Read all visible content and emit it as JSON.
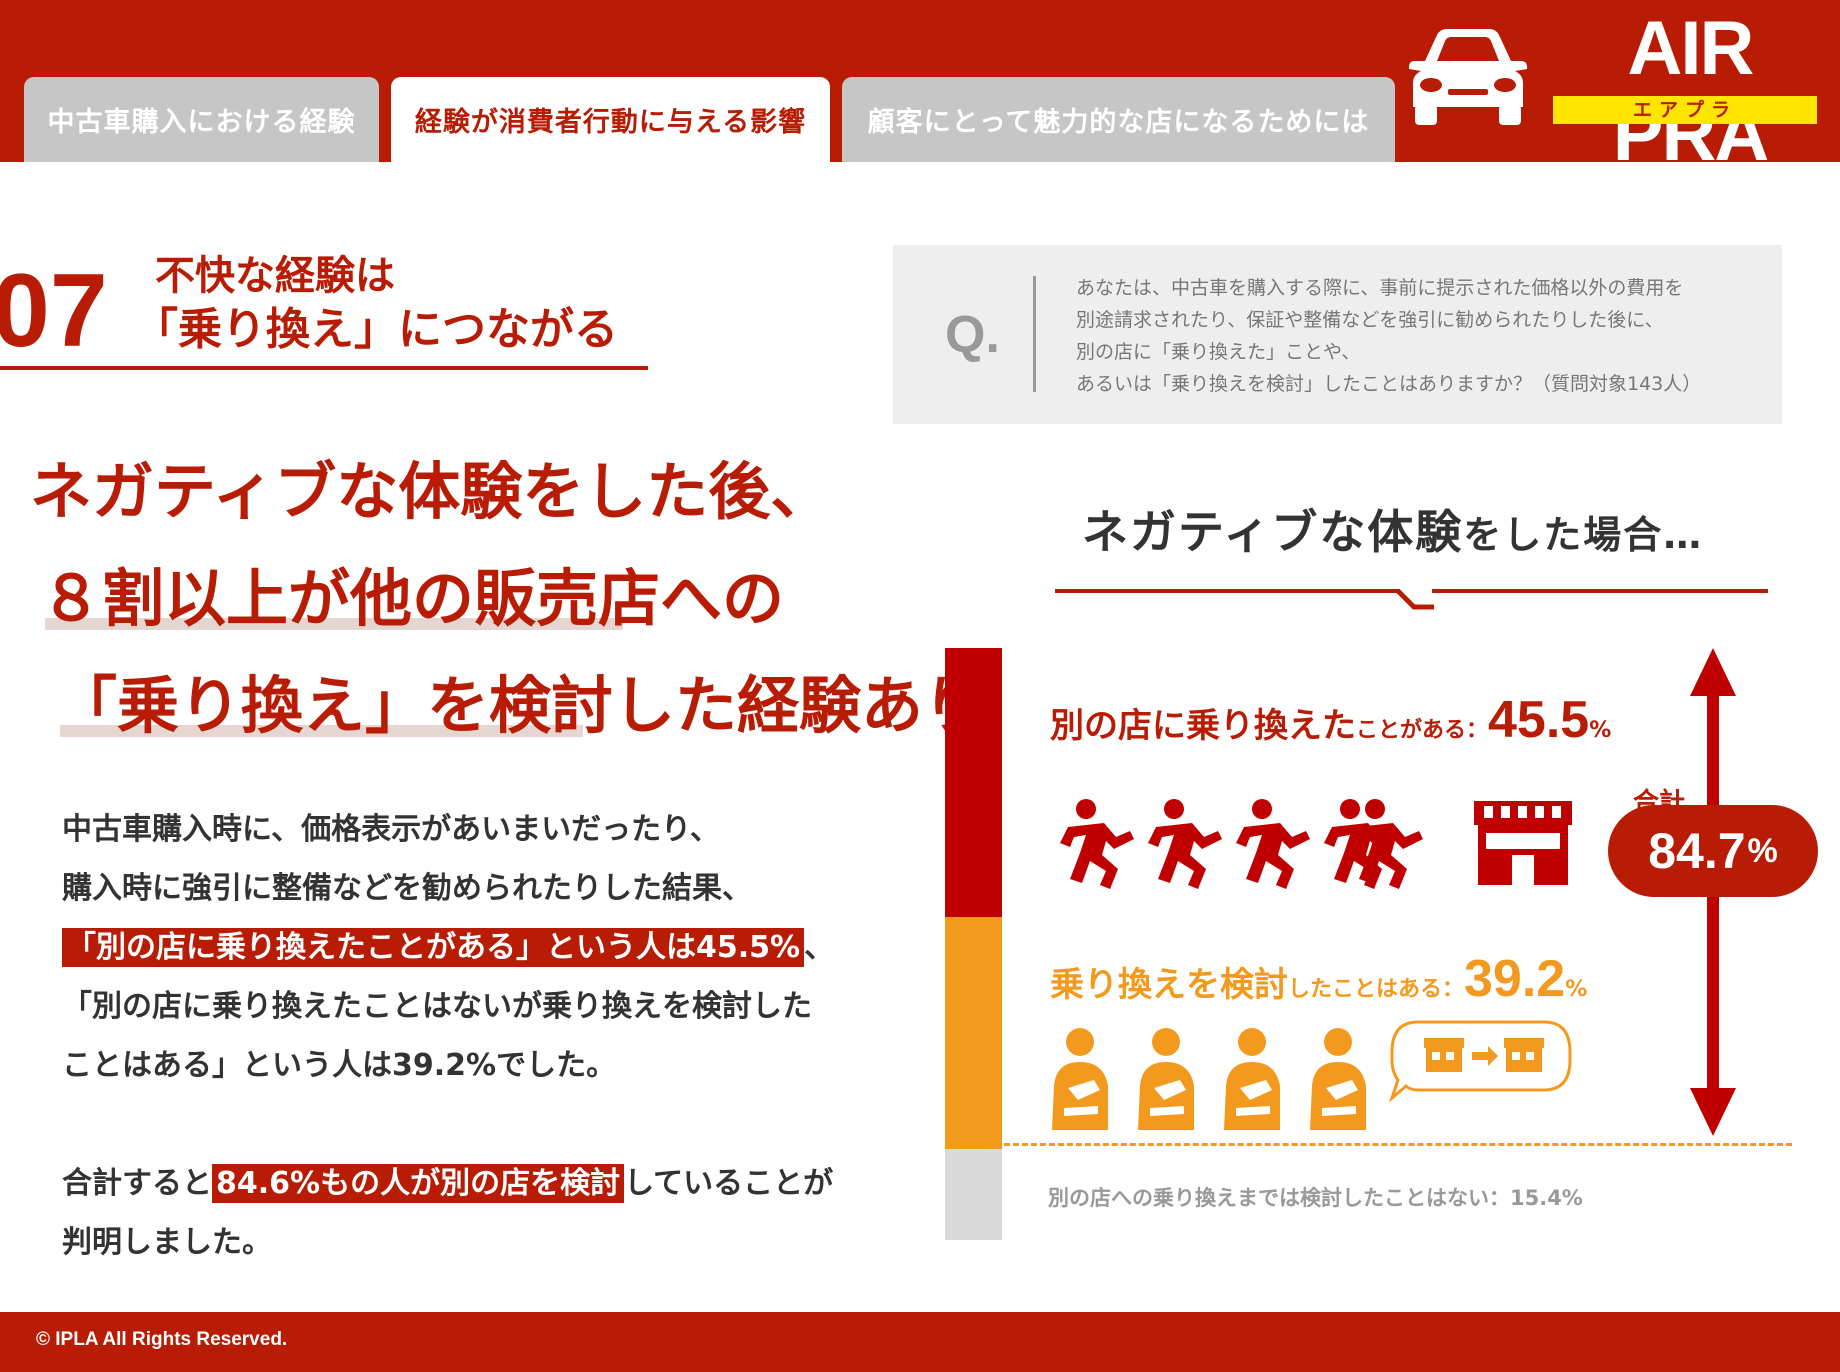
{
  "tabs": [
    {
      "label": "中古車購入における経験"
    },
    {
      "label": "経験が消費者行動に与える影響"
    },
    {
      "label": "顧客にとって魅力的な店になるためには"
    }
  ],
  "active_tab": 1,
  "logo": {
    "text": "AIR PRA",
    "sub": "エアプラ"
  },
  "section": {
    "number": "07",
    "title_line1": "不快な経験は",
    "title_line2": "「乗り換え」につながる"
  },
  "headline": {
    "line1": "ネガティブな体験をした後、",
    "line2": "８割以上が他の販売店への",
    "line3": "「乗り換え」を検討した経験あり"
  },
  "body": {
    "line1": "中古車購入時に、価格表示があいまいだったり、",
    "line2": "購入時に強引に整備などを勧められたりした結果、",
    "line3_highlight": "「別の店に乗り換えたことがある」という人は45.5%",
    "line3_after": "、",
    "line4": "「別の店に乗り換えたことはないが乗り換えを検討した",
    "line5": "ことはある」という人は39.2%でした。",
    "line6_before": "合計すると",
    "line6_highlight": "84.6%もの人が別の店を検討",
    "line6_after": "していることが",
    "line7": "判明しました。"
  },
  "question": {
    "mark": "Q.",
    "line1": "あなたは、中古車を購入する際に、事前に提示された価格以外の費用を",
    "line2": "別途請求されたり、保証や整備などを強引に勧められたりした後に、",
    "line3": "別の店に「乗り換えた」ことや、",
    "line4": "あるいは「乗り換えを検討」したことはありますか？（質問対象143人）"
  },
  "chart_title": {
    "main": "ネガティブな体験",
    "rest": "をした場合…"
  },
  "results": {
    "switched": {
      "label_main": "別の店に乗り換えた",
      "label_sub": "ことがある：",
      "value": "45.5",
      "unit": "%"
    },
    "considered": {
      "label_main": "乗り換えを検討",
      "label_sub": "したことはある：",
      "value": "39.2",
      "unit": "%"
    },
    "none": {
      "label": "別の店への乗り換えまでは検討したことはない：15.4%"
    },
    "total_label": "合計",
    "total_value": "84.7",
    "total_unit": "%"
  },
  "chart_data": {
    "type": "bar",
    "categories": [
      "別の店に乗り換えたことがある",
      "乗り換えを検討したことはある",
      "別の店への乗り換えまでは検討したことはない"
    ],
    "values": [
      45.5,
      39.2,
      15.4
    ],
    "colors": [
      "#c00000",
      "#f39a1e",
      "#d9d9d9"
    ]
  },
  "footer": {
    "copyright": "© IPLA All Rights Reserved."
  },
  "colors": {
    "brand": "#b81c05",
    "accent": "#f39a1e",
    "logo_yellow": "#ffe600"
  },
  "icons": [
    "car-icon",
    "running-person-icon",
    "store-icon",
    "thinking-person-icon",
    "store-switch-icon",
    "arrow-icon"
  ]
}
